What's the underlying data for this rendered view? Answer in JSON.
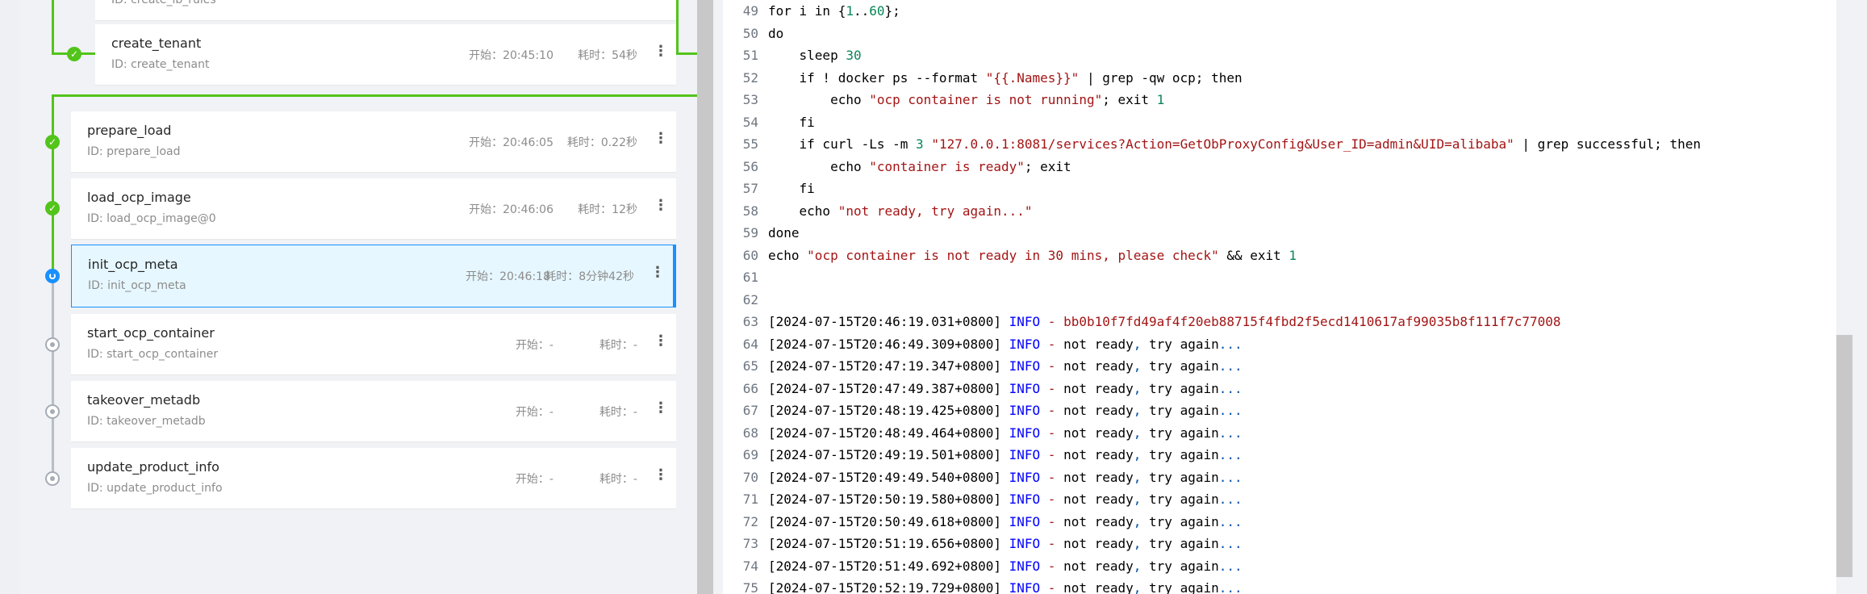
{
  "tasks": [
    {
      "id_text": "ID: create_lb_rules",
      "status": "done"
    },
    {
      "name": "create_tenant",
      "id_text": "ID: create_tenant",
      "start": "开始：20:45:10",
      "duration": "耗时：54秒",
      "status": "done"
    },
    {
      "name": "prepare_load",
      "id_text": "ID: prepare_load",
      "start": "开始：20:46:05",
      "duration": "耗时：0.22秒",
      "status": "done"
    },
    {
      "name": "load_ocp_image",
      "id_text": "ID: load_ocp_image@0",
      "start": "开始：20:46:06",
      "duration": "耗时：12秒",
      "status": "done"
    },
    {
      "name": "init_ocp_meta",
      "id_text": "ID: init_ocp_meta",
      "start": "开始：20:46:18",
      "duration": "耗时：8分钟42秒",
      "status": "running"
    },
    {
      "name": "start_ocp_container",
      "id_text": "ID: start_ocp_container",
      "start": "开始：-",
      "duration": "耗时：-",
      "status": "pending"
    },
    {
      "name": "takeover_metadb",
      "id_text": "ID: takeover_metadb",
      "start": "开始：-",
      "duration": "耗时：-",
      "status": "pending"
    },
    {
      "name": "update_product_info",
      "id_text": "ID: update_product_info",
      "start": "开始：-",
      "duration": "耗时：-",
      "status": "pending"
    }
  ],
  "code": {
    "line_numbers": [
      "49",
      "50",
      "51",
      "52",
      "53",
      "54",
      "55",
      "56",
      "57",
      "58",
      "59",
      "60",
      "61",
      "62",
      "63",
      "64",
      "65",
      "66",
      "67",
      "68",
      "69",
      "70",
      "71",
      "72",
      "73",
      "74",
      "75"
    ],
    "script": {
      "l49_a": "for i in {",
      "l49_b": "1",
      "l49_c": "..",
      "l49_d": "60",
      "l49_e": "};",
      "l50": "do",
      "l51_a": "    sleep ",
      "l51_b": "30",
      "l52_a": "    if ! docker ps --format ",
      "l52_b": "\"{{.Names}}\"",
      "l52_c": " | grep -qw ocp; then",
      "l53_a": "        echo ",
      "l53_b": "\"ocp container is not running\"",
      "l53_c": "; exit ",
      "l53_d": "1",
      "l54": "    fi",
      "l55_a": "    if curl -Ls -m ",
      "l55_b": "3",
      "l55_c": " ",
      "l55_d": "\"127.0.0.1:8081/services?Action=GetObProxyConfig&User_ID=admin&UID=alibaba\"",
      "l55_e": " | grep successful; then",
      "l56_a": "        echo ",
      "l56_b": "\"container is ready\"",
      "l56_c": "; exit",
      "l57": "    fi",
      "l58_a": "    echo ",
      "l58_b": "\"not ready, try again...\"",
      "l59": "done",
      "l60_a": "echo ",
      "l60_b": "\"ocp container is not ready in 30 mins, please check\"",
      "l60_c": " && exit ",
      "l60_d": "1"
    },
    "log_level": "INFO",
    "log_sep": " - ",
    "log_first_ts": "[2024-07-15T20:46:19.031+0800]",
    "log_first_msg": "bb0b10f7fd49af4f20eb88715f4fbd2f5ecd1410617af99035b8f111f7c77008",
    "log_msg_a": "not ready",
    "log_msg_comma": ",",
    "log_msg_b": " try again",
    "log_msg_dots": "...",
    "log_timestamps": [
      "[2024-07-15T20:46:49.309+0800]",
      "[2024-07-15T20:47:19.347+0800]",
      "[2024-07-15T20:47:49.387+0800]",
      "[2024-07-15T20:48:19.425+0800]",
      "[2024-07-15T20:48:49.464+0800]",
      "[2024-07-15T20:49:19.501+0800]",
      "[2024-07-15T20:49:49.540+0800]",
      "[2024-07-15T20:50:19.580+0800]",
      "[2024-07-15T20:50:49.618+0800]",
      "[2024-07-15T20:51:19.656+0800]",
      "[2024-07-15T20:51:49.692+0800]",
      "[2024-07-15T20:52:19.729+0800]"
    ]
  },
  "icons": {
    "done": "check-circle-icon",
    "running": "loading-circle-icon",
    "pending": "pending-circle-icon",
    "more": "more-vertical-icon"
  },
  "colors": {
    "success": "#52c41a",
    "active": "#1890ff",
    "active_bg": "#e6f7ff",
    "string": "#a31515",
    "number": "#098658",
    "keyword_info": "#0000ff"
  }
}
